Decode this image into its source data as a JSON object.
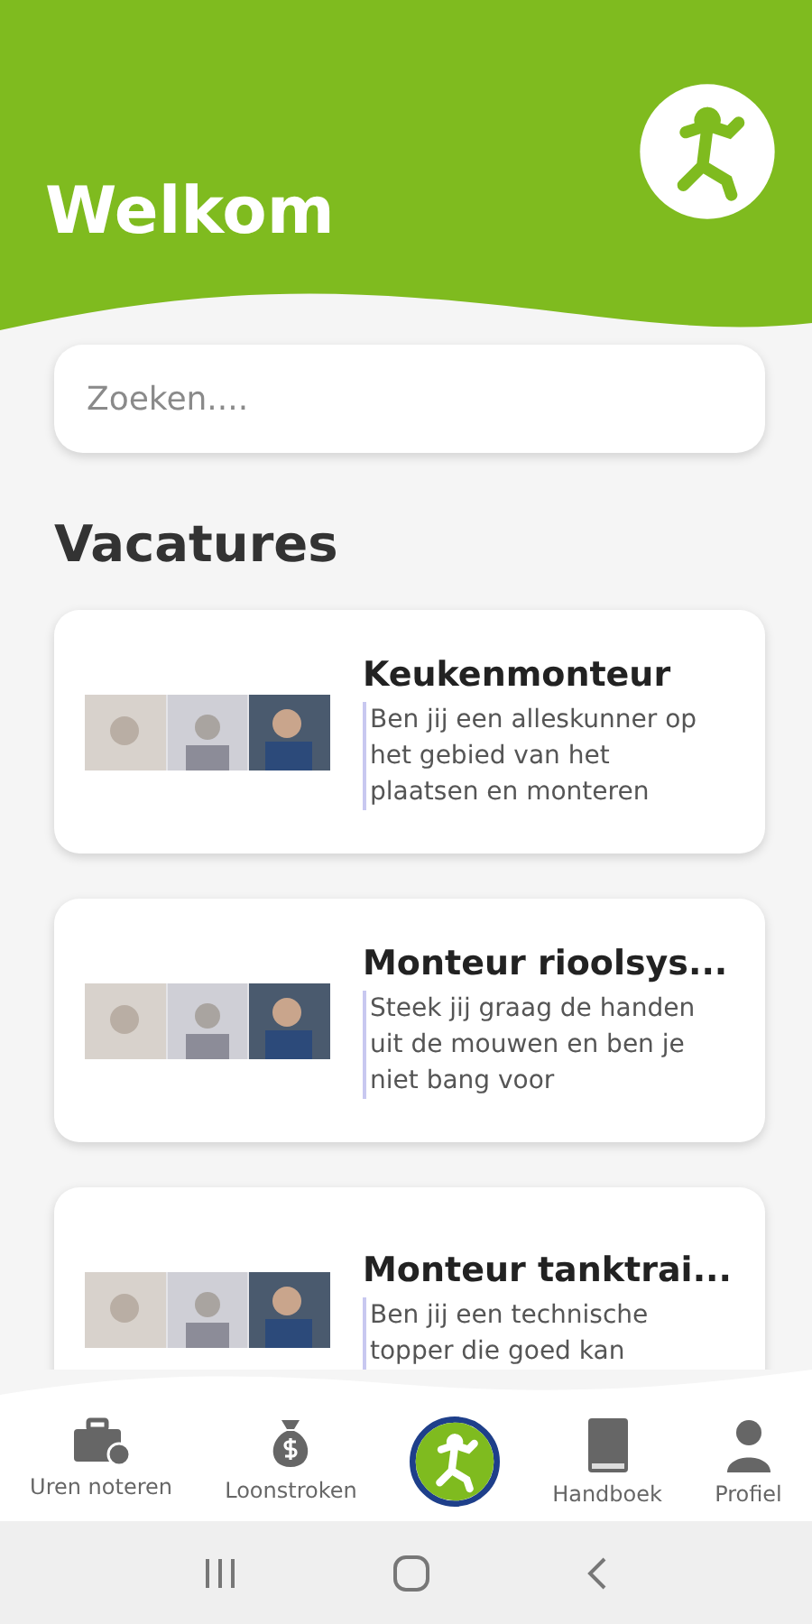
{
  "header": {
    "title": "Welkom"
  },
  "search": {
    "placeholder": "Zoeken...."
  },
  "section_title": "Vacatures",
  "vacancies": [
    {
      "title": "Keukenmonteur",
      "description": "Ben jij een alleskunner op het gebied van het plaatsen en monteren"
    },
    {
      "title": "Monteur rioolsys...",
      "description": "Steek jij graag de handen uit de mouwen en ben je niet bang voor"
    },
    {
      "title": "Monteur tanktrai...",
      "description": "Ben jij een technische topper die goed kan"
    }
  ],
  "nav": [
    {
      "kind": "briefcase",
      "label": "Uren noteren"
    },
    {
      "kind": "moneybag",
      "label": "Loonstroken"
    },
    {
      "kind": "logo"
    },
    {
      "kind": "book",
      "label": "Handboek"
    },
    {
      "kind": "person",
      "label": "Profiel"
    }
  ]
}
